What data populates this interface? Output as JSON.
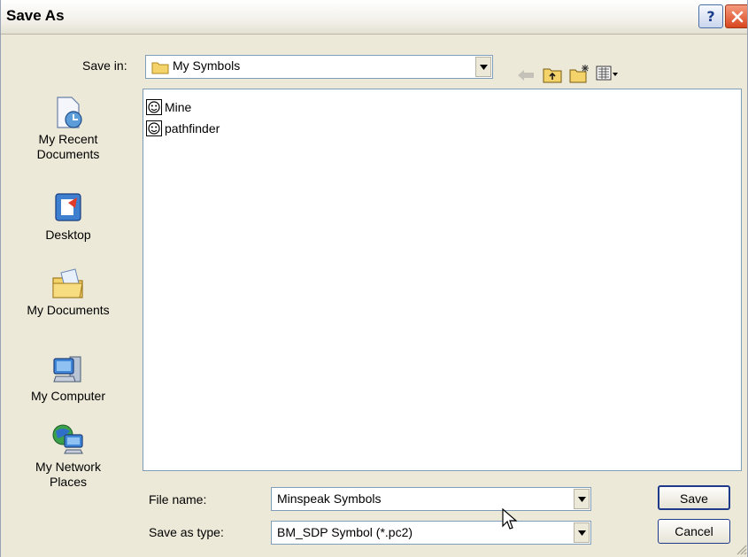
{
  "window": {
    "title": "Save As"
  },
  "titlebar": {
    "help_icon": "question-icon",
    "close_icon": "close-x-icon"
  },
  "save_in": {
    "label": "Save in:",
    "value": "My Symbols"
  },
  "toolbar": {
    "back_icon": "back-arrow-icon",
    "up_icon": "folder-up-icon",
    "new_folder_icon": "new-folder-icon",
    "views_icon": "views-menu-icon"
  },
  "places": [
    {
      "label_lines": [
        "My Recent",
        "Documents"
      ],
      "icon": "recent-documents-icon"
    },
    {
      "label_lines": [
        "Desktop"
      ],
      "icon": "desktop-icon"
    },
    {
      "label_lines": [
        "My Documents"
      ],
      "icon": "my-documents-icon"
    },
    {
      "label_lines": [
        "My Computer"
      ],
      "icon": "my-computer-icon"
    },
    {
      "label_lines": [
        "My Network",
        "Places"
      ],
      "icon": "my-network-icon"
    }
  ],
  "files": [
    {
      "name": "Mine",
      "icon": "symbol-file-icon"
    },
    {
      "name": "pathfinder",
      "icon": "symbol-file-icon"
    }
  ],
  "file_name": {
    "label": "File name:",
    "value": "Minspeak Symbols"
  },
  "save_as_type": {
    "label": "Save as type:",
    "value": "BM_SDP Symbol (*.pc2)"
  },
  "buttons": {
    "save": "Save",
    "cancel": "Cancel"
  }
}
